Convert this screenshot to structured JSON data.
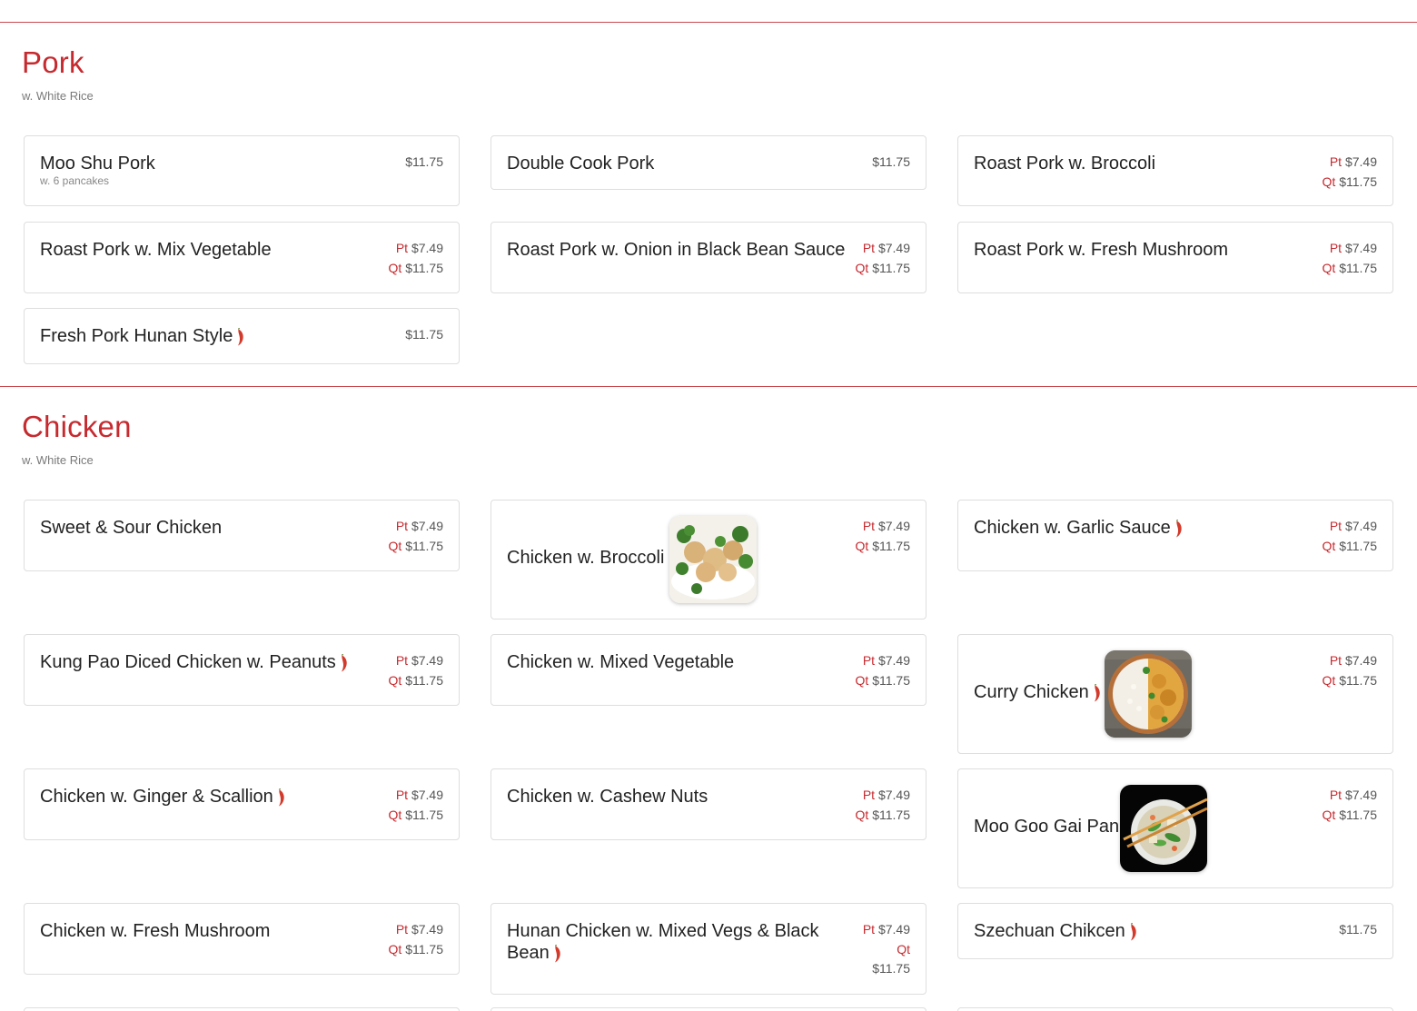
{
  "sections": [
    {
      "title": "Pork",
      "subtitle": "w. White Rice",
      "items": [
        {
          "name": "Moo Shu Pork",
          "note": "w. 6 pancakes",
          "price": "$11.75"
        },
        {
          "name": "Double Cook Pork",
          "price": "$11.75"
        },
        {
          "name": "Roast Pork w. Broccoli",
          "pt": "$7.49",
          "qt": "$11.75"
        },
        {
          "name": "Roast Pork w. Mix Vegetable",
          "pt": "$7.49",
          "qt": "$11.75"
        },
        {
          "name": "Roast Pork w. Onion in Black Bean Sauce",
          "pt": "$7.49",
          "qt": "$11.75"
        },
        {
          "name": "Roast Pork w. Fresh Mushroom",
          "pt": "$7.49",
          "qt": "$11.75"
        },
        {
          "name": "Fresh Pork Hunan Style",
          "spicy": true,
          "price": "$11.75"
        }
      ]
    },
    {
      "title": "Chicken",
      "subtitle": "w. White Rice",
      "items": [
        {
          "name": "Sweet & Sour Chicken",
          "pt": "$7.49",
          "qt": "$11.75"
        },
        {
          "name": "Chicken w. Broccoli",
          "pt": "$7.49",
          "qt": "$11.75",
          "image": "chicken-broccoli-photo"
        },
        {
          "name": "Chicken w. Garlic Sauce",
          "spicy": true,
          "pt": "$7.49",
          "qt": "$11.75"
        },
        {
          "name": "Kung Pao Diced Chicken w. Peanuts",
          "spicy": true,
          "pt": "$7.49",
          "qt": "$11.75"
        },
        {
          "name": "Chicken w. Mixed Vegetable",
          "pt": "$7.49",
          "qt": "$11.75"
        },
        {
          "name": "Curry Chicken",
          "spicy": true,
          "pt": "$7.49",
          "qt": "$11.75",
          "image": "curry-chicken-photo"
        },
        {
          "name": "Chicken w. Ginger & Scallion",
          "spicy": true,
          "pt": "$7.49",
          "qt": "$11.75"
        },
        {
          "name": "Chicken w. Cashew Nuts",
          "pt": "$7.49",
          "qt": "$11.75"
        },
        {
          "name": "Moo Goo Gai Pan",
          "pt": "$7.49",
          "qt": "$11.75",
          "image": "moo-goo-gai-pan-photo"
        },
        {
          "name": "Chicken w. Fresh Mushroom",
          "pt": "$7.49",
          "qt": "$11.75"
        },
        {
          "name": "Hunan Chicken w. Mixed Vegs & Black Bean",
          "spicy": true,
          "pt": "$7.49",
          "qt": "$11.75"
        },
        {
          "name": "Szechuan Chikcen",
          "spicy": true,
          "price": "$11.75"
        }
      ]
    }
  ],
  "labels": {
    "pt": "Pt",
    "qt": "Qt"
  },
  "icons": {
    "spicy": "chili-pepper-icon"
  },
  "colors": {
    "accent": "#c62a2f",
    "divider": "#c9494d",
    "border": "#dedede"
  }
}
